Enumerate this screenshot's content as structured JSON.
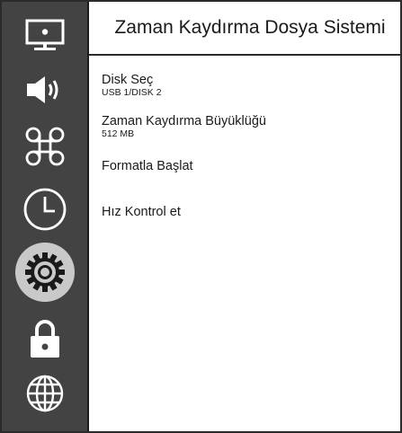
{
  "header": {
    "title": "Zaman Kaydırma Dosya Sistemi"
  },
  "sidebar": {
    "items": [
      {
        "icon": "picture-settings-icon",
        "selected": false
      },
      {
        "icon": "speaker-icon",
        "selected": false
      },
      {
        "icon": "command-icon",
        "selected": false
      },
      {
        "icon": "clock-icon",
        "selected": false
      },
      {
        "icon": "gear-icon",
        "selected": true
      },
      {
        "icon": "lock-icon",
        "selected": false
      },
      {
        "icon": "globe-icon",
        "selected": false
      }
    ]
  },
  "menu": {
    "items": [
      {
        "label": "Disk Seç",
        "value": "USB 1/DISK 2"
      },
      {
        "label": "Zaman Kaydırma Büyüklüğü",
        "value": "512 MB"
      },
      {
        "label": "Formatla Başlat"
      },
      {
        "label": "Hız Kontrol et"
      }
    ]
  },
  "colors": {
    "sidebar_bg": "#434343",
    "selected_bg": "#c9c9c9",
    "icon_color": "#ffffff",
    "text_color": "#1a1a1a"
  }
}
